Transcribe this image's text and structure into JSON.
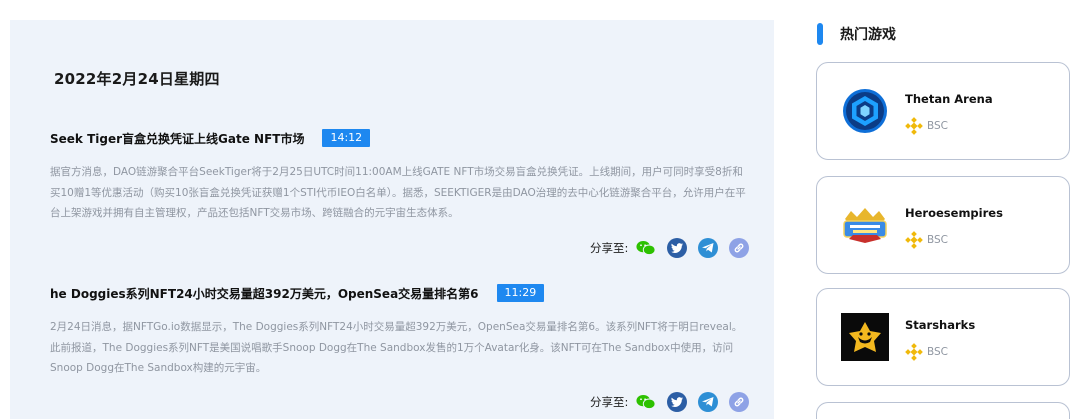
{
  "news": {
    "date_heading": "2022年2月24日星期四",
    "share_label": "分享至:",
    "items": [
      {
        "title": "Seek Tiger盲盒兑换凭证上线Gate NFT市场",
        "time": "14:12",
        "body": "据官方消息，DAO链游聚合平台SeekTiger将于2月25日UTC时间11:00AM上线GATE NFT市场交易盲盒兑换凭证。上线期间，用户可同时享受8折和买10赠1等优惠活动（购买10张盲盒兑换凭证获赠1个STI代币IEO白名单）。据悉，SEEKTIGER是由DAO治理的去中心化链游聚合平台，允许用户在平台上架游戏并拥有自主管理权，产品还包括NFT交易市场、跨链融合的元宇宙生态体系。"
      },
      {
        "title": "he Doggies系列NFT24小时交易量超392万美元，OpenSea交易量排名第6",
        "time": "11:29",
        "body": "2月24日消息，据NFTGo.io数据显示，The Doggies系列NFT24小时交易量超392万美元，OpenSea交易量排名第6。该系列NFT将于明日reveal。此前报道，The Doggies系列NFT是美国说唱歌手Snoop Dogg在The Sandbox发售的1万个Avatar化身。该NFT可在The Sandbox中使用，访问Snoop Dogg在The Sandbox构建的元宇宙。"
      }
    ]
  },
  "sidebar": {
    "title": "热门游戏",
    "games": [
      {
        "name": "Thetan Arena",
        "chain": "BSC",
        "logo_icon": "thetan-arena-logo"
      },
      {
        "name": "Heroesempires",
        "chain": "BSC",
        "logo_icon": "heroes-empires-logo"
      },
      {
        "name": "Starsharks",
        "chain": "BSC",
        "logo_icon": "starsharks-logo"
      }
    ]
  },
  "colors": {
    "accent": "#1e88f0",
    "panel_bg": "#eef3fa",
    "body_text": "#8f96a1",
    "bsc_yellow": "#f0b90b"
  }
}
